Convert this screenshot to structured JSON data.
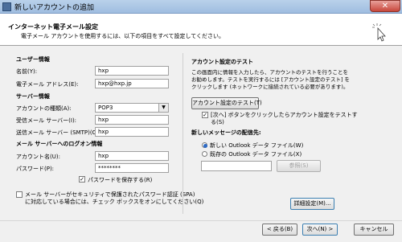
{
  "window": {
    "title": "新しいアカウントの追加",
    "close_label": "✕"
  },
  "header": {
    "title": "インターネット電子メール設定",
    "subtitle": "電子メール アカウントを使用するには、以下の項目をすべて設定してください。"
  },
  "user_info": {
    "section": "ユーザー情報",
    "name_label": "名前(Y):",
    "name_value": "hxp",
    "email_label": "電子メール アドレス(E):",
    "email_value": "hxp@hxp.jp"
  },
  "server_info": {
    "section": "サーバー情報",
    "account_type_label": "アカウントの種類(A):",
    "account_type_value": "POP3",
    "incoming_label": "受信メール サーバー(I):",
    "incoming_value": "hxp",
    "outgoing_label": "送信メール サーバー (SMTP)(O):",
    "outgoing_value": "hxp"
  },
  "login_info": {
    "section": "メール サーバーへのログオン情報",
    "account_name_label": "アカウント名(U):",
    "account_name_value": "hxp",
    "password_label": "パスワード(P):",
    "password_value": "********",
    "remember_label": "パスワードを保存する(R)",
    "remember_checked": true,
    "spa_label_line1": "メール サーバーがセキュリティで保護されたパスワード認証 (SPA)",
    "spa_label_line2": "に対応している場合には、チェック ボックスをオンにしてください(Q)",
    "spa_checked": false
  },
  "test": {
    "section": "アカウント設定のテスト",
    "description_line1": "この画面内に情報を入力したら、アカウントのテストを行うことを",
    "description_line2": "お勧めします。テストを実行するには [アカウント設定のテスト] を",
    "description_line3": "クリックします (ネットワークに接続されている必要があります)。",
    "test_button": "アカウント設定のテスト(T)",
    "auto_test_line1": "[次へ] ボタンをクリックしたらアカウント設定をテストす",
    "auto_test_line2": "る(S)",
    "auto_test_checked": true
  },
  "delivery": {
    "section": "新しいメッセージの配信先:",
    "option_new": "新しい Outlook データ ファイル(W)",
    "option_existing": "既存の Outlook データ ファイル(X)",
    "selected": "option_new",
    "browse_button": "参照(S)",
    "file_path_value": ""
  },
  "more_settings_button": "詳細設定(M)...",
  "footer": {
    "back_button": "< 戻る(B)",
    "next_button": "次へ(N) >",
    "cancel_button": "キャンセル"
  },
  "colors": {
    "title_gradient_top": "#b9d1ea",
    "close_red": "#c8473c",
    "focus_blue": "#3c7fb1"
  }
}
